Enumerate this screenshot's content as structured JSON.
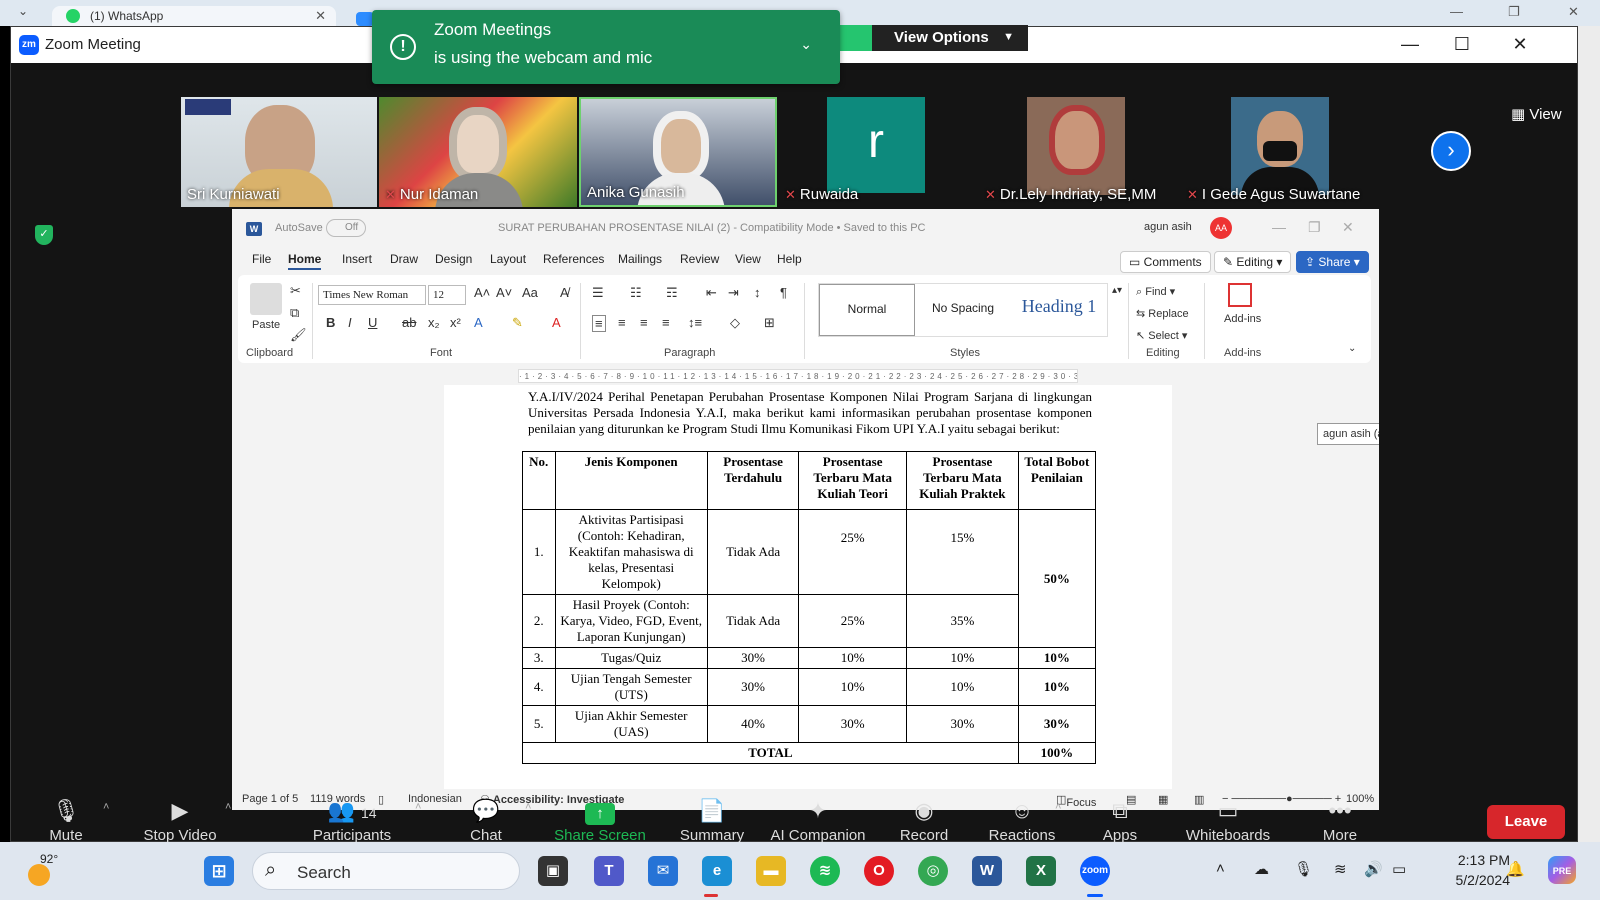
{
  "background_browser": {
    "tab_title": "(1) WhatsApp"
  },
  "zoom": {
    "window_title": "Zoom Meeting",
    "notification": {
      "line1": "Zoom Meetings",
      "line2": "is using the webcam and mic"
    },
    "view_options": "View Options",
    "view_button": "View",
    "participants": [
      {
        "name": "Sri Kurniawati",
        "muted": false
      },
      {
        "name": "Nur Idaman",
        "muted": true
      },
      {
        "name": "Anika Gunasih",
        "muted": false
      },
      {
        "name": "Ruwaida",
        "muted": true,
        "initial": "r"
      },
      {
        "name": "Dr.Lely Indriaty, SE,MM",
        "muted": true
      },
      {
        "name": "I Gede Agus Suwartane",
        "muted": true
      }
    ],
    "toolbar": {
      "mute": "Mute",
      "stop_video": "Stop Video",
      "participants": "Participants",
      "participants_count": "14",
      "chat": "Chat",
      "share_screen": "Share Screen",
      "summary": "Summary",
      "ai_companion": "AI Companion",
      "record": "Record",
      "reactions": "Reactions",
      "apps": "Apps",
      "whiteboards": "Whiteboards",
      "more": "More",
      "leave": "Leave"
    },
    "colors": {
      "accent": "#0e72ed",
      "share_green": "#1db954",
      "leave_red": "#d7262b",
      "notification_green": "#1a8b57"
    }
  },
  "word": {
    "autosave": "AutoSave",
    "autosave_state": "Off",
    "doc_title": "SURAT PERUBAHAN PROSENTASE NILAI (2) - Compatibility Mode • Saved to this PC",
    "user": "agun asih",
    "user_initials": "AA",
    "menu": [
      "File",
      "Home",
      "Insert",
      "Draw",
      "Design",
      "Layout",
      "References",
      "Mailings",
      "Review",
      "View",
      "Help"
    ],
    "comments": "Comments",
    "editing": "Editing",
    "share": "Share",
    "ribbon": {
      "paste": "Paste",
      "font_name": "Times New Roman",
      "font_size": "12",
      "styles": [
        "Normal",
        "No Spacing",
        "Heading 1"
      ],
      "find": "Find",
      "replace": "Replace",
      "select": "Select",
      "addins": "Add-ins",
      "groups": [
        "Clipboard",
        "Font",
        "Paragraph",
        "Styles",
        "Editing",
        "Add-ins"
      ]
    },
    "paragraph": "Y.A.I/IV/2024 Perihal Penetapan Perubahan Prosentase Komponen Nilai Program Sarjana di lingkungan Universitas Persada Indonesia Y.A.I, maka berikut kami informasikan perubahan prosentase komponen penilaian yang diturunkan ke Program Studi Ilmu Komunikasi Fikom UPI Y.A.I yaitu sebagai berikut:",
    "tooltip": "agun asih (agunasih@gmail.com) is signed in",
    "table": {
      "headers": [
        "No.",
        "Jenis Komponen",
        "Prosentase Terdahulu",
        "Prosentase Terbaru Mata Kuliah Teori",
        "Prosentase Terbaru Mata Kuliah Praktek",
        "Total Bobot Penilaian"
      ],
      "rows": [
        {
          "no": "1.",
          "komponen": "Aktivitas Partisipasi (Contoh: Kehadiran, Keaktifan mahasiswa di kelas, Presentasi Kelompok)",
          "terdahulu": "Tidak Ada",
          "teori": "25%",
          "praktek": "15%",
          "total": "50%"
        },
        {
          "no": "2.",
          "komponen": "Hasil Proyek (Contoh: Karya, Video, FGD, Event, Laporan Kunjungan)",
          "terdahulu": "Tidak Ada",
          "teori": "25%",
          "praktek": "35%",
          "total": ""
        },
        {
          "no": "3.",
          "komponen": "Tugas/Quiz",
          "terdahulu": "30%",
          "teori": "10%",
          "praktek": "10%",
          "total": "10%"
        },
        {
          "no": "4.",
          "komponen": "Ujian Tengah Semester (UTS)",
          "terdahulu": "30%",
          "teori": "10%",
          "praktek": "10%",
          "total": "10%"
        },
        {
          "no": "5.",
          "komponen": "Ujian Akhir Semester (UAS)",
          "terdahulu": "40%",
          "teori": "30%",
          "praktek": "30%",
          "total": "30%"
        }
      ],
      "total_label": "TOTAL",
      "total_value": "100%"
    },
    "status": {
      "page": "Page 1 of 5",
      "words": "1119 words",
      "language": "Indonesian",
      "accessibility": "Accessibility: Investigate",
      "focus": "Focus",
      "zoom": "100%"
    }
  },
  "taskbar": {
    "weather": "92°",
    "search": "Search",
    "time": "2:13 PM",
    "date": "5/2/2024"
  }
}
